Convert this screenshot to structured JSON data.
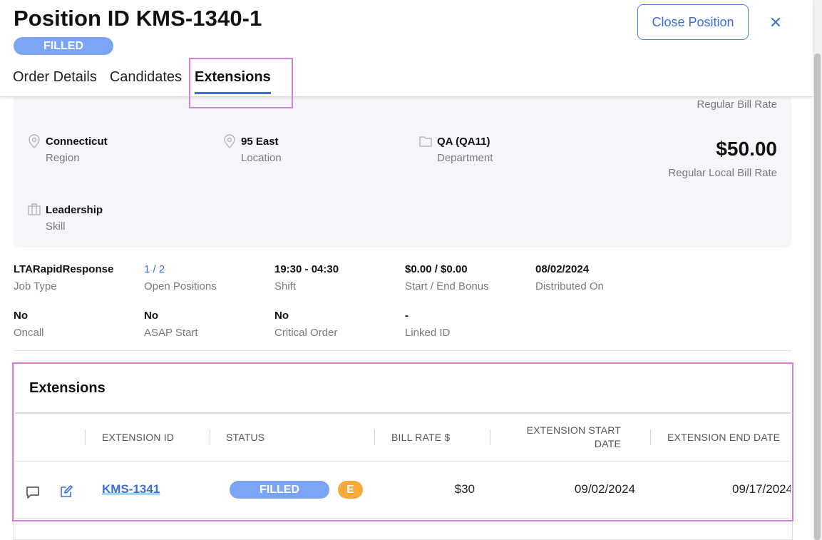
{
  "header": {
    "title": "Position ID KMS-1340-1",
    "status": "FILLED",
    "close_position_label": "Close Position",
    "close_icon": "close-icon",
    "tabs": [
      {
        "label": "Order Details",
        "active": false
      },
      {
        "label": "Candidates",
        "active": false
      },
      {
        "label": "Extensions",
        "active": true
      }
    ]
  },
  "info_card": {
    "regular_bill_rate_label": "Regular Bill Rate",
    "regular_local_bill_rate_value": "$50.00",
    "regular_local_bill_rate_label": "Regular Local Bill Rate",
    "region": {
      "value": "Connecticut",
      "label": "Region",
      "icon": "map-pin-icon"
    },
    "location": {
      "value": "95 East",
      "label": "Location",
      "icon": "map-pin-icon"
    },
    "department": {
      "value": "QA (QA11)",
      "label": "Department",
      "icon": "folder-icon"
    },
    "skill": {
      "value": "Leadership",
      "label": "Skill",
      "icon": "briefcase-icon"
    }
  },
  "details": [
    {
      "value": "LTARapidResponse",
      "label": "Job Type"
    },
    {
      "value": "1 / 2",
      "label": "Open Positions"
    },
    {
      "value": "19:30 - 04:30",
      "label": "Shift"
    },
    {
      "value": "$0.00 / $0.00",
      "label": "Start / End Bonus"
    },
    {
      "value": "08/02/2024",
      "label": "Distributed On"
    },
    {
      "value": "No",
      "label": "Oncall"
    },
    {
      "value": "No",
      "label": "ASAP Start"
    },
    {
      "value": "No",
      "label": "Critical Order"
    },
    {
      "value": "-",
      "label": "Linked ID"
    }
  ],
  "extensions": {
    "title": "Extensions",
    "columns": {
      "extension_id": "EXTENSION ID",
      "status": "STATUS",
      "bill_rate": "BILL RATE $",
      "start_date_line1": "EXTENSION START",
      "start_date_line2": "DATE",
      "end_date": "EXTENSION END DATE"
    },
    "rows": [
      {
        "extension_id": "KMS-1341",
        "status": "FILLED",
        "badge": "E",
        "bill_rate": "$30",
        "start_date": "09/02/2024",
        "end_date": "09/17/2024"
      }
    ]
  },
  "colors": {
    "accent": "#3b6fd8",
    "status_pill": "#7ba4f4",
    "badge_orange": "#f4a93a",
    "highlight": "#d77fdc"
  }
}
